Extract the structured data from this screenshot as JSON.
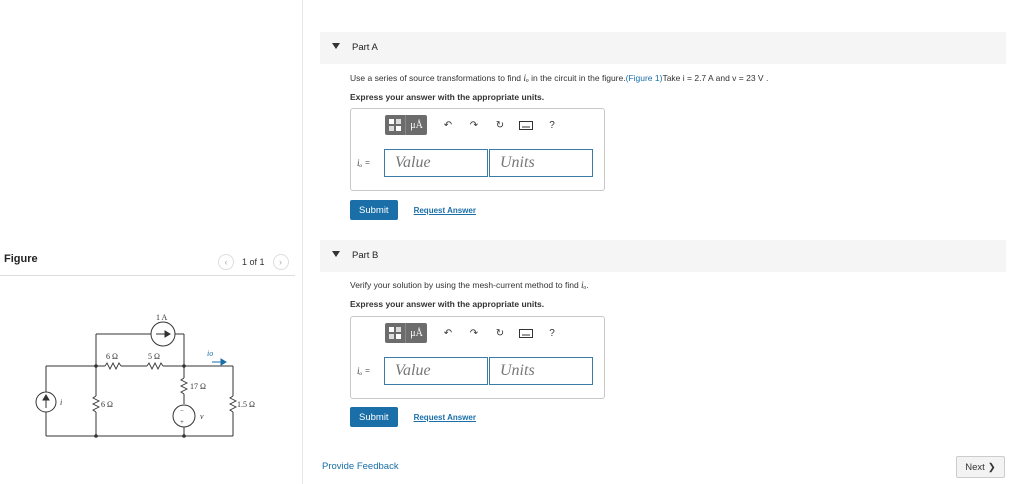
{
  "figure": {
    "title": "Figure",
    "pager": {
      "text": "1 of 1",
      "prev_icon": "chevron-left-icon",
      "next_icon": "chevron-right-icon"
    },
    "circuit": {
      "current_source_top": "1 A",
      "resistor_6": "6 Ω",
      "resistor_5": "5 Ω",
      "resistor_17": "17 Ω",
      "resistor_6_vertical": "6 Ω",
      "resistor_1_5": "1.5 Ω",
      "source_i_label": "i",
      "source_v_label": "v",
      "current_io_label": "io"
    }
  },
  "parts": [
    {
      "title": "Part A",
      "question_pre": "Use a series of source transformations to find ",
      "question_var": "iₒ",
      "question_mid": " in the circuit in the figure.",
      "figure_link": "(Figure 1)",
      "question_post": "Take i = 2.7 A and v = 23 V .",
      "express": "Express your answer with the appropriate units.",
      "toolbar_mu": "μÅ",
      "toolbar_help": "?",
      "var_label": "iₒ =",
      "value_placeholder": "Value",
      "units_placeholder": "Units",
      "submit": "Submit",
      "request": "Request Answer"
    },
    {
      "title": "Part B",
      "question_pre": "Verify your solution by using the mesh-current method to find ",
      "question_var": "iₒ",
      "question_post": ".",
      "express": "Express your answer with the appropriate units.",
      "toolbar_mu": "μÅ",
      "toolbar_help": "?",
      "var_label": "iₒ =",
      "value_placeholder": "Value",
      "units_placeholder": "Units",
      "submit": "Submit",
      "request": "Request Answer"
    }
  ],
  "footer": {
    "feedback": "Provide Feedback",
    "next": "Next"
  }
}
